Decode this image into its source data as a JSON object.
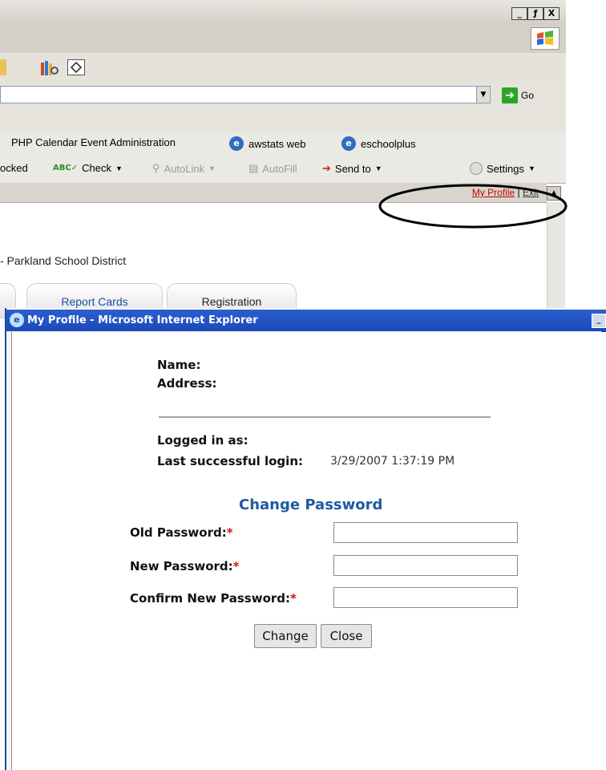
{
  "window_controls": {
    "minimize": "_",
    "restore": "ƒ",
    "close": "X"
  },
  "address_bar": {
    "value": "",
    "go_label": "Go"
  },
  "links_bar": {
    "items": [
      {
        "label": "PHP Calendar Event Administration"
      },
      {
        "label": "awstats web"
      },
      {
        "label": "eschoolplus"
      }
    ]
  },
  "google_toolbar": {
    "blocked_label": "ocked",
    "check_label": "Check",
    "autolink_label": "AutoLink",
    "autofill_label": "AutoFill",
    "sendto_label": "Send to",
    "settings_label": "Settings"
  },
  "profile_strip": {
    "my_profile": "My Profile",
    "separator": "|",
    "exit": "Exit"
  },
  "page": {
    "district": "- Parkland School District",
    "tabs": [
      "Report Cards",
      "Registration"
    ]
  },
  "popup": {
    "title": "My Profile - Microsoft Internet Explorer",
    "name_label": "Name:",
    "address_label": "Address:",
    "logged_in_label": "Logged in as:",
    "last_login_label": "Last successful login:",
    "last_login_value": "3/29/2007 1:37:19 PM",
    "change_password_title": "Change Password",
    "old_password_label": "Old Password:",
    "new_password_label": "New Password:",
    "confirm_password_label": "Confirm New Password:",
    "required_marker": "*",
    "change_button": "Change",
    "close_button": "Close"
  },
  "colors": {
    "accent_blue": "#1e5aa0",
    "required_red": "#d01010",
    "profile_link_red": "#c80000",
    "title_blue": "#1d49b8"
  }
}
